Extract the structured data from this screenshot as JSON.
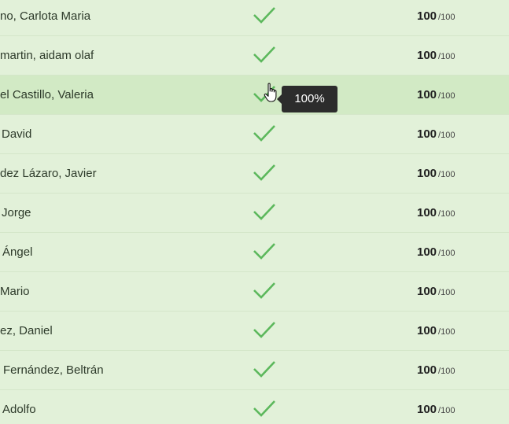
{
  "rows": [
    {
      "name": "no, Carlota Maria",
      "score": "100",
      "max": "/100"
    },
    {
      "name": "martin, aidam olaf",
      "score": "100",
      "max": "/100"
    },
    {
      "name": "el Castillo, Valeria",
      "score": "100",
      "max": "/100"
    },
    {
      "name": "David",
      "score": "100",
      "max": "/100"
    },
    {
      "name": "dez Lázaro, Javier",
      "score": "100",
      "max": "/100"
    },
    {
      "name": "Jorge",
      "score": "100",
      "max": "/100"
    },
    {
      "name": "Ángel",
      "score": "100",
      "max": "/100"
    },
    {
      "name": "Mario",
      "score": "100",
      "max": "/100"
    },
    {
      "name": "ez, Daniel",
      "score": "100",
      "max": "/100"
    },
    {
      "name": "Fernández, Beltrán",
      "score": "100",
      "max": "/100"
    },
    {
      "name": "Adolfo",
      "score": "100",
      "max": "/100"
    }
  ],
  "tooltip": {
    "text": "100%"
  },
  "colors": {
    "check": "#5cb85c",
    "row_bg": "#e2f1d9",
    "row_hover_bg": "#d2eac5",
    "tooltip_bg": "#2c2c2c"
  },
  "icons": {
    "status": "checkmark-icon",
    "cursor": "hand-pointer-icon"
  }
}
